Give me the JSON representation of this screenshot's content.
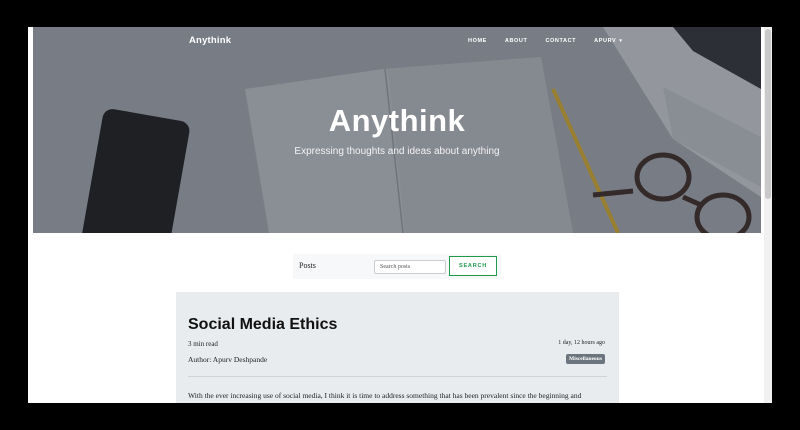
{
  "nav": {
    "brand": "Anythink",
    "items": [
      {
        "label": "HOME"
      },
      {
        "label": "ABOUT"
      },
      {
        "label": "CONTACT"
      },
      {
        "label": "APURV"
      }
    ]
  },
  "hero": {
    "title": "Anythink",
    "subtitle": "Expressing thoughts and ideas about anything"
  },
  "search": {
    "label": "Posts",
    "placeholder": "Search posts",
    "button_label": "SEARCH"
  },
  "post": {
    "title": "Social Media Ethics",
    "read_time": "3 min read",
    "time_ago": "1 day, 12 hours ago",
    "author": "Author: Apurv Deshpande",
    "tag": "Miscellaneous",
    "excerpt": "With the ever increasing use of social media, I think it is time to address something that has been prevalent since the beginning and"
  },
  "colors": {
    "accent": "#1e9a4d",
    "card_bg": "#e8ecef",
    "tag_bg": "#6c757d"
  }
}
